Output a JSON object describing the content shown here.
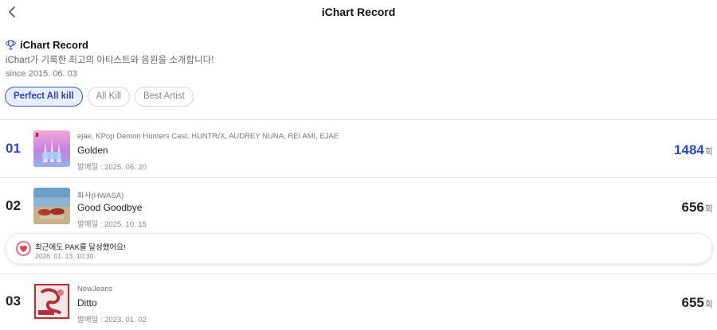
{
  "header": {
    "title": "iChart Record"
  },
  "intro": {
    "title": "iChart Record",
    "description": "iChart가 기록한 최고의 아티스트와 음원을 소개합니다!",
    "since": "since 2015. 06. 03"
  },
  "tabs": [
    {
      "label": "Perfect All kill",
      "active": true
    },
    {
      "label": "All Kill",
      "active": false
    },
    {
      "label": "Best Artist",
      "active": false
    }
  ],
  "records": [
    {
      "rank": "01",
      "artist": "ejae, KPop Demon Hunters Cast, HUNTR/X, AUDREY NUNA, REI AMI, EJAE",
      "title": "Golden",
      "release": "발매일 : 2025. 06. 20",
      "count": "1484",
      "unit": "회"
    },
    {
      "rank": "02",
      "artist": "화사(HWASA)",
      "title": "Good Goodbye",
      "release": "발매일 : 2025. 10. 15",
      "count": "656",
      "unit": "회"
    },
    {
      "rank": "03",
      "artist": "NewJeans",
      "title": "Ditto",
      "release": "발매일 : 2023. 01. 02",
      "count": "655",
      "unit": "회"
    }
  ],
  "pak_notice": {
    "message": "최근에도 PAK를 달성했어요!",
    "time": "2026. 01. 13. 10:30"
  },
  "colors": {
    "accent": "#2b48c8",
    "tab_active_bg": "#e8edff",
    "heart": "#e0405a"
  },
  "icons": {
    "back": "chevron-left-icon",
    "trophy": "trophy-icon",
    "heart": "heart-icon"
  }
}
